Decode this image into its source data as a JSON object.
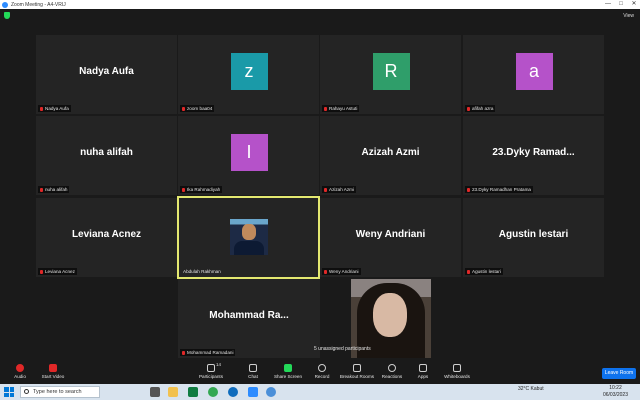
{
  "window": {
    "title": "Zoom Meeting - A4-VRIJ",
    "minimize": "—",
    "maximize": "□",
    "close": "✕"
  },
  "view": {
    "label": "View"
  },
  "tiles": [
    {
      "display": "Nadya Aufa",
      "label": "Nadya Aufa"
    },
    {
      "avatar_letter": "z",
      "avatar_color": "#1a9aa8",
      "label": "zoom baa04"
    },
    {
      "avatar_letter": "R",
      "avatar_color": "#2f9e6a",
      "label": "Rahayu Astuti"
    },
    {
      "avatar_letter": "a",
      "avatar_color": "#b552c9",
      "label": "afifah azra"
    },
    {
      "display": "nuha alifah",
      "label": "nuha alifah"
    },
    {
      "avatar_letter": "I",
      "avatar_color": "#b552c9",
      "label": "Ika Rahmadiyah"
    },
    {
      "display": "Azizah Azmi",
      "label": "Azizah Azmi"
    },
    {
      "display": "23.Dyky  Ramad...",
      "label": "23.Dyky Ramadhan Pratama"
    },
    {
      "display": "Leviana Acnez",
      "label": "Leviana Acnez"
    },
    {
      "label": "Abdulah Rakhman"
    },
    {
      "display": "Weny Andriani",
      "label": "Weny Andriani"
    },
    {
      "display": "Agustin lestari",
      "label": "Agustin lestari"
    },
    {
      "display": "Mohammad  Ra...",
      "label": "Mohammad Ramadani"
    }
  ],
  "unassigned": "5 unassigned participants",
  "toolbar": {
    "audio": "Audio",
    "start_video": "Start Video",
    "participants": "Participants",
    "participants_count": "14",
    "chat": "Chat",
    "share_screen": "Share Screen",
    "record": "Record",
    "breakout_rooms": "Breakout Rooms",
    "reactions": "Reactions",
    "apps": "Apps",
    "whiteboards": "Whiteboards",
    "leave": "Leave Room"
  },
  "taskbar": {
    "search_placeholder": "Type here to search",
    "weather": "32°C  Kabut",
    "time": "10:22",
    "date": "06/03/2023"
  }
}
